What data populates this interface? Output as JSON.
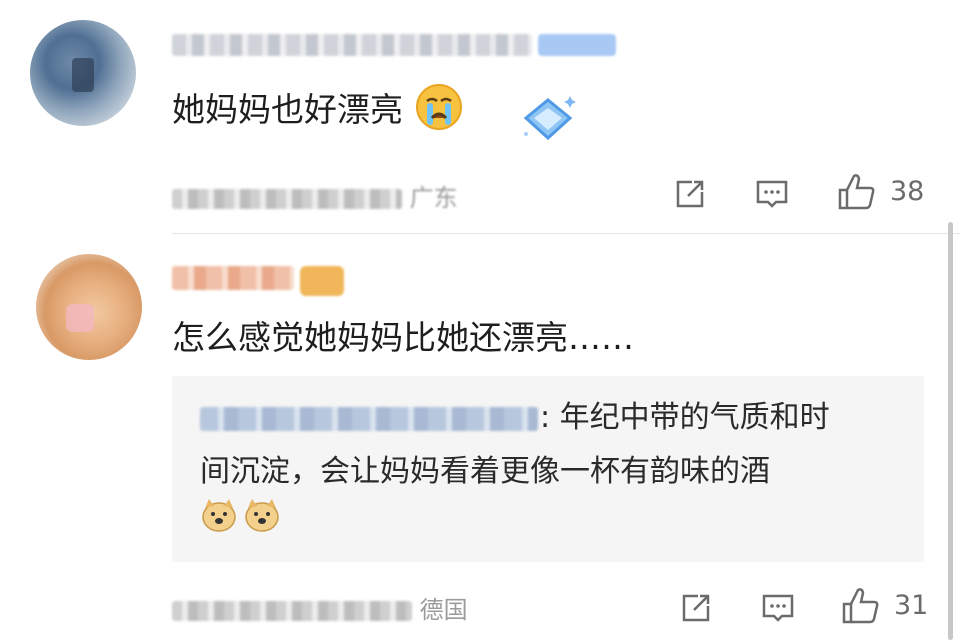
{
  "comments": [
    {
      "text": "她妈妈也好漂亮",
      "emoji": "crying-face-icon",
      "badge": "diamond-badge-icon",
      "location_suffix": "广东",
      "likes": "38"
    },
    {
      "text": "怎么感觉她妈妈比她还漂亮……",
      "reply": {
        "line1": ": 年纪中带的气质和时",
        "line2": "间沉淀，会让妈妈看着更像一杯有韵味的酒",
        "emojis": [
          "doge-icon",
          "doge-icon"
        ]
      },
      "location_suffix": "德国",
      "likes": "31"
    }
  ],
  "colors": {
    "text": "#1e1e1e",
    "meta": "#9b9b9b",
    "reply_bg": "#f5f5f5"
  }
}
